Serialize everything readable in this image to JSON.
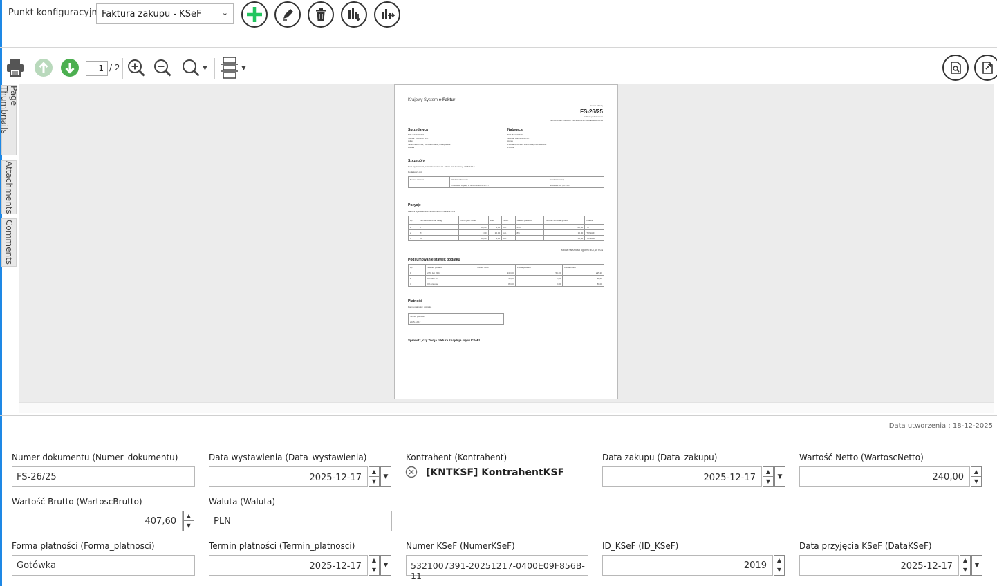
{
  "toolbar": {
    "config_label": "Punkt konfiguracyjny",
    "config_value": "Faktura zakupu - KSeF"
  },
  "viewer": {
    "page_current": "1",
    "page_total": "/ 2",
    "side_tabs": [
      "Page Thumbnails",
      "Attachments",
      "Comments"
    ]
  },
  "doc": {
    "system_title_prefix": "Krajowy System ",
    "system_title_accent": "e-Faktur",
    "invoice_label": "Numer faktury",
    "invoice_number": "FS-26/25",
    "invoice_type": "Faktura podstawowa",
    "ksef_line": "Numer KSeF: 5321007391-20251217-0400E09F856B-11",
    "seller_title": "Sprzedawca",
    "seller_lines": [
      "NIP: 5321007391",
      "Nazwa: Comarch S.A.",
      "Adres",
      "Jana Pawła 2/13, 20-489 Kraków, małopolskie",
      "Polska"
    ],
    "buyer_title": "Nabywca",
    "buyer_lines": [
      "NIP: 5321007391",
      "Nazwa: KontrahentKSF",
      "Adres",
      "Piękna 4, 00-234 Warszawa, mazowieckie",
      "Polska"
    ],
    "details_title": "Szczegóły",
    "details_line": "Data wystawienia, z zastrzeżeniem art. 106na ust. 1 ustawy: 2025-12-17",
    "details_sub": "Dodatkowy opis",
    "details_headers": [
      "Numer wiersza",
      "Rodzaj informacji",
      "Treść informacji"
    ],
    "details_row": [
      "",
      "Kwota do zapłaty w terminie 2025-12-17",
      "Gotówka 407,60 PLN"
    ],
    "positions_title": "Pozycje",
    "positions_sub": "Faktura wystawiona w cenach netto w walucie PLN",
    "positions_headers": [
      "Lp.",
      "Nazwa towaru lub usługi",
      "Cena jedn. netto",
      "Ilość",
      "Jedn.",
      "Stawka podatku",
      "Wartość sprzedaży netto",
      "Indeks"
    ],
    "positions_rows": [
      [
        "1",
        "T",
        "80,00",
        "4,00",
        "szt.",
        "23%",
        "240,00",
        "T1"
      ],
      [
        "2",
        "T1",
        "3,00",
        "10,00",
        "szt.",
        "8%",
        "30,00",
        "TOWAR1"
      ],
      [
        "3",
        "T2",
        "80,00",
        "1,00",
        "szt.",
        "",
        "80,00",
        "TOWAR2"
      ]
    ],
    "total_line": "Kwota należności ogółem: 407,60 PLN",
    "tax_title": "Podsumowanie stawek podatku",
    "tax_headers": [
      "Lp.",
      "Stawka podatku",
      "Kwota netto",
      "Kwota podatku",
      "Kwota brutto"
    ],
    "tax_rows": [
      [
        "1",
        "23% lub 22%",
        "240,00",
        "55,20",
        "295,20"
      ],
      [
        "2",
        "8% lub 7%",
        "30,00",
        "2,40",
        "32,40"
      ],
      [
        "3",
        "0% krajowe",
        "80,00",
        "0,00",
        "80,00"
      ]
    ],
    "payment_title": "Płatność",
    "payment_form": "Forma płatności: gotówka",
    "payment_headers": [
      "Termin płatności"
    ],
    "payment_row": [
      "2025-12-17"
    ],
    "check_line": "Sprawdź, czy Twoja faktura znajduje się w KSeF!"
  },
  "form": {
    "created": "Data utworzenia : 18-12-2025",
    "fields": {
      "numer_dokumentu": {
        "label": "Numer dokumentu (Numer_dokumentu)",
        "value": "FS-26/25"
      },
      "data_wystawienia": {
        "label": "Data wystawienia (Data_wystawienia)",
        "value": "2025-12-17"
      },
      "kontrahent": {
        "label": "Kontrahent (Kontrahent)",
        "value": "[KNTKSF] KontrahentKSF"
      },
      "data_zakupu": {
        "label": "Data zakupu (Data_zakupu)",
        "value": "2025-12-17"
      },
      "wartosc_netto": {
        "label": "Wartość Netto (WartoscNetto)",
        "value": "240,00"
      },
      "wartosc_brutto": {
        "label": "Wartość Brutto (WartoscBrutto)",
        "value": "407,60"
      },
      "waluta": {
        "label": "Waluta (Waluta)",
        "value": "PLN"
      },
      "forma_platnosci": {
        "label": "Forma płatności (Forma_platnosci)",
        "value": "Gotówka"
      },
      "termin_platnosci": {
        "label": "Termin płatności (Termin_platnosci)",
        "value": "2025-12-17"
      },
      "numer_ksef": {
        "label": "Numer KSeF (NumerKSeF)",
        "value": "5321007391-20251217-0400E09F856B-11"
      },
      "id_ksef": {
        "label": "ID_KSeF (ID_KSeF)",
        "value": "2019"
      },
      "data_przyjecia": {
        "label": "Data przyjęcia KSeF (DataKSeF)",
        "value": "2025-12-17"
      }
    }
  },
  "colors": {
    "accent": "#1e88e5",
    "add_green": "#22c55e",
    "nav_green": "#4caf50"
  }
}
